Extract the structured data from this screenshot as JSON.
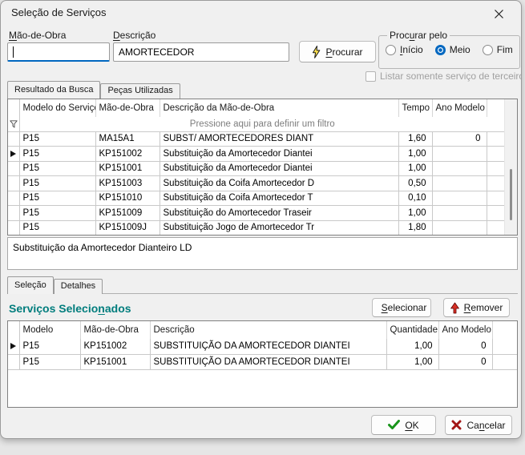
{
  "window": {
    "title": "Seleção de Serviços"
  },
  "form": {
    "mao_label": [
      "",
      "M",
      "ão-de-Obra"
    ],
    "mao_value": "",
    "desc_label": [
      "",
      "D",
      "escrição"
    ],
    "desc_value": "AMORTECEDOR",
    "procurar_label": [
      "",
      "P",
      "rocurar"
    ],
    "groupbox_label": [
      "Proc",
      "u",
      "rar pelo"
    ],
    "radio_inicio": [
      "",
      "I",
      "nício"
    ],
    "radio_meio": "Meio",
    "radio_fim": "Fim",
    "selected_radio": "Meio",
    "checkbox_label": "Listar somente serviço de terceiros"
  },
  "tabs_results": [
    "Resultado da Busca",
    "Peças Utilizadas"
  ],
  "results_grid": {
    "columns": [
      "Modelo do Serviço",
      "Mão-de-Obra",
      "Descrição da Mão-de-Obra",
      "Tempo",
      "Ano Modelo"
    ],
    "filter_hint": "Pressione aqui para definir um filtro",
    "rows": [
      {
        "modelo": "P15",
        "mao": "MA15A1",
        "desc": "SUBST/ AMORTECEDORES DIANT",
        "tempo": "1,60",
        "ano": "0"
      },
      {
        "modelo": "P15",
        "mao": "KP151002",
        "desc": "Substituição da Amortecedor Diantei",
        "tempo": "1,00",
        "ano": ""
      },
      {
        "modelo": "P15",
        "mao": "KP151001",
        "desc": "Substituição da Amortecedor Diantei",
        "tempo": "1,00",
        "ano": ""
      },
      {
        "modelo": "P15",
        "mao": "KP151003",
        "desc": "Substituição da Coifa Amortecedor D",
        "tempo": "0,50",
        "ano": ""
      },
      {
        "modelo": "P15",
        "mao": "KP151010",
        "desc": "Substituição da Coifa Amortecedor T",
        "tempo": "0,10",
        "ano": ""
      },
      {
        "modelo": "P15",
        "mao": "KP151009",
        "desc": "Substituição do Amortecedor Traseir",
        "tempo": "1,00",
        "ano": ""
      },
      {
        "modelo": "P15",
        "mao": "KP151009J",
        "desc": "Substituição Jogo de Amortecedor Tr",
        "tempo": "1,80",
        "ano": ""
      }
    ]
  },
  "status_text": "Substituição da Amortecedor Dianteiro LD",
  "tabs_selection": [
    "Seleção",
    "Detalhes"
  ],
  "selection": {
    "title": [
      "Serviços Selecio",
      "n",
      "ados"
    ],
    "selecionar_label": [
      "",
      "S",
      "elecionar"
    ],
    "remover_label": [
      "",
      "R",
      "emover"
    ]
  },
  "selected_grid": {
    "columns": [
      "Modelo",
      "Mão-de-Obra",
      "Descrição",
      "Quantidade",
      "Ano Modelo"
    ],
    "rows": [
      {
        "modelo": "P15",
        "mao": "KP151002",
        "desc": "SUBSTITUIÇÃO DA AMORTECEDOR DIANTEI",
        "qtd": "1,00",
        "ano": "0"
      },
      {
        "modelo": "P15",
        "mao": "KP151001",
        "desc": "SUBSTITUIÇÃO DA AMORTECEDOR DIANTEI",
        "qtd": "1,00",
        "ano": "0"
      }
    ]
  },
  "footer": {
    "ok_label": [
      "",
      "O",
      "K"
    ],
    "cancel_label": [
      "Ca",
      "n",
      "celar"
    ]
  },
  "colors": {
    "accent_blue": "#0067c0",
    "title_teal": "#007d7d",
    "icon_red": "#d83025",
    "icon_green": "#18941a",
    "icon_yellow": "#ffe14d"
  }
}
